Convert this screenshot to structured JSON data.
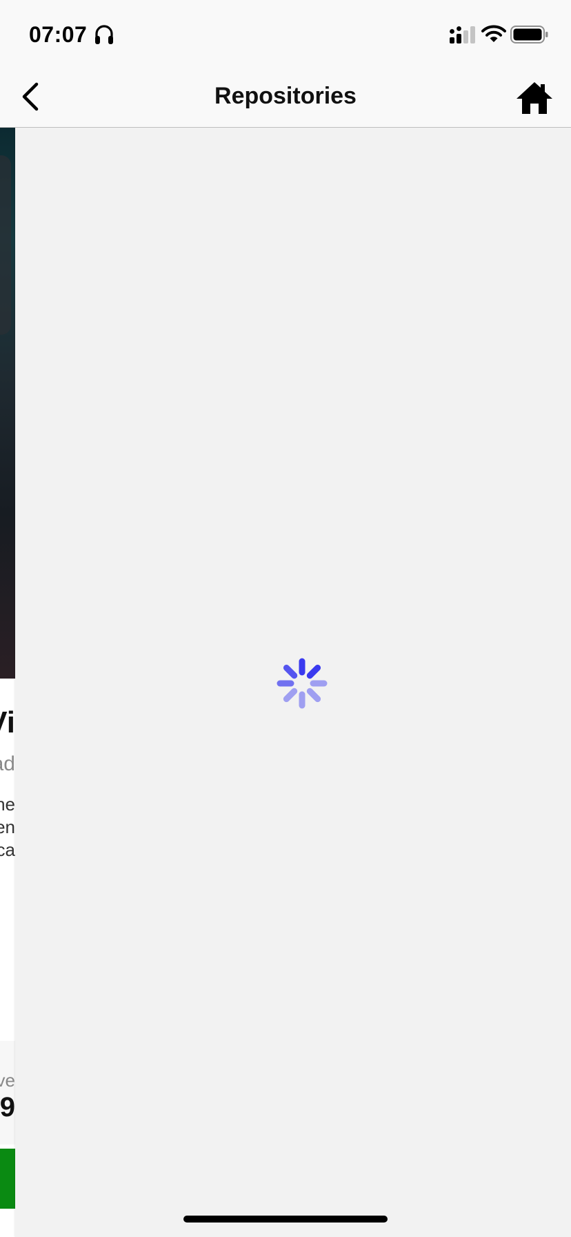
{
  "status_bar": {
    "time": "07:07",
    "icons": [
      "headphones-icon",
      "cellular-signal-icon",
      "wifi-icon",
      "battery-icon"
    ]
  },
  "nav": {
    "title": "Repositories",
    "back_icon": "chevron-left-icon",
    "home_icon": "home-icon"
  },
  "background_screen": {
    "name_fragment": "Vi",
    "handle_fragment": "ad",
    "bio_fragments": [
      "ne",
      "en",
      "ca"
    ],
    "stat_label_fragment": "ve",
    "stat_value_fragment": "9"
  },
  "loading": {
    "indicator": "activity-spinner",
    "color": "#3a3aef"
  },
  "colors": {
    "background": "#f2f2f2",
    "bar_background": "#f9f9f9",
    "spinner": "#3a3aef",
    "action_green": "#0a8a12"
  }
}
